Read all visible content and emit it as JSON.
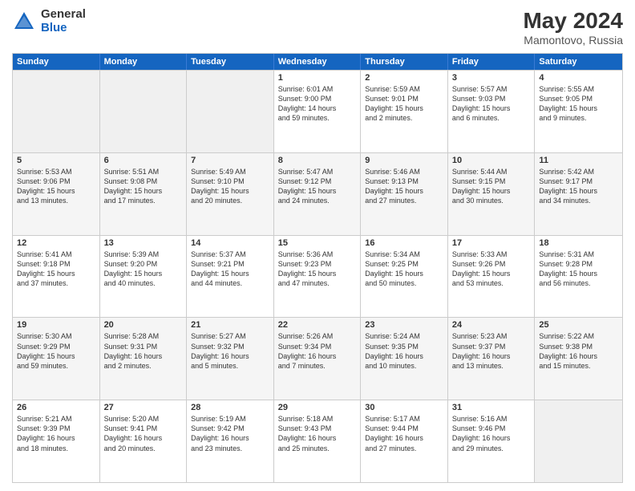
{
  "logo": {
    "general": "General",
    "blue": "Blue"
  },
  "title": "May 2024",
  "subtitle": "Mamontovo, Russia",
  "days": [
    "Sunday",
    "Monday",
    "Tuesday",
    "Wednesday",
    "Thursday",
    "Friday",
    "Saturday"
  ],
  "rows": [
    [
      {
        "day": "",
        "info": ""
      },
      {
        "day": "",
        "info": ""
      },
      {
        "day": "",
        "info": ""
      },
      {
        "day": "1",
        "info": "Sunrise: 6:01 AM\nSunset: 9:00 PM\nDaylight: 14 hours\nand 59 minutes."
      },
      {
        "day": "2",
        "info": "Sunrise: 5:59 AM\nSunset: 9:01 PM\nDaylight: 15 hours\nand 2 minutes."
      },
      {
        "day": "3",
        "info": "Sunrise: 5:57 AM\nSunset: 9:03 PM\nDaylight: 15 hours\nand 6 minutes."
      },
      {
        "day": "4",
        "info": "Sunrise: 5:55 AM\nSunset: 9:05 PM\nDaylight: 15 hours\nand 9 minutes."
      }
    ],
    [
      {
        "day": "5",
        "info": "Sunrise: 5:53 AM\nSunset: 9:06 PM\nDaylight: 15 hours\nand 13 minutes."
      },
      {
        "day": "6",
        "info": "Sunrise: 5:51 AM\nSunset: 9:08 PM\nDaylight: 15 hours\nand 17 minutes."
      },
      {
        "day": "7",
        "info": "Sunrise: 5:49 AM\nSunset: 9:10 PM\nDaylight: 15 hours\nand 20 minutes."
      },
      {
        "day": "8",
        "info": "Sunrise: 5:47 AM\nSunset: 9:12 PM\nDaylight: 15 hours\nand 24 minutes."
      },
      {
        "day": "9",
        "info": "Sunrise: 5:46 AM\nSunset: 9:13 PM\nDaylight: 15 hours\nand 27 minutes."
      },
      {
        "day": "10",
        "info": "Sunrise: 5:44 AM\nSunset: 9:15 PM\nDaylight: 15 hours\nand 30 minutes."
      },
      {
        "day": "11",
        "info": "Sunrise: 5:42 AM\nSunset: 9:17 PM\nDaylight: 15 hours\nand 34 minutes."
      }
    ],
    [
      {
        "day": "12",
        "info": "Sunrise: 5:41 AM\nSunset: 9:18 PM\nDaylight: 15 hours\nand 37 minutes."
      },
      {
        "day": "13",
        "info": "Sunrise: 5:39 AM\nSunset: 9:20 PM\nDaylight: 15 hours\nand 40 minutes."
      },
      {
        "day": "14",
        "info": "Sunrise: 5:37 AM\nSunset: 9:21 PM\nDaylight: 15 hours\nand 44 minutes."
      },
      {
        "day": "15",
        "info": "Sunrise: 5:36 AM\nSunset: 9:23 PM\nDaylight: 15 hours\nand 47 minutes."
      },
      {
        "day": "16",
        "info": "Sunrise: 5:34 AM\nSunset: 9:25 PM\nDaylight: 15 hours\nand 50 minutes."
      },
      {
        "day": "17",
        "info": "Sunrise: 5:33 AM\nSunset: 9:26 PM\nDaylight: 15 hours\nand 53 minutes."
      },
      {
        "day": "18",
        "info": "Sunrise: 5:31 AM\nSunset: 9:28 PM\nDaylight: 15 hours\nand 56 minutes."
      }
    ],
    [
      {
        "day": "19",
        "info": "Sunrise: 5:30 AM\nSunset: 9:29 PM\nDaylight: 15 hours\nand 59 minutes."
      },
      {
        "day": "20",
        "info": "Sunrise: 5:28 AM\nSunset: 9:31 PM\nDaylight: 16 hours\nand 2 minutes."
      },
      {
        "day": "21",
        "info": "Sunrise: 5:27 AM\nSunset: 9:32 PM\nDaylight: 16 hours\nand 5 minutes."
      },
      {
        "day": "22",
        "info": "Sunrise: 5:26 AM\nSunset: 9:34 PM\nDaylight: 16 hours\nand 7 minutes."
      },
      {
        "day": "23",
        "info": "Sunrise: 5:24 AM\nSunset: 9:35 PM\nDaylight: 16 hours\nand 10 minutes."
      },
      {
        "day": "24",
        "info": "Sunrise: 5:23 AM\nSunset: 9:37 PM\nDaylight: 16 hours\nand 13 minutes."
      },
      {
        "day": "25",
        "info": "Sunrise: 5:22 AM\nSunset: 9:38 PM\nDaylight: 16 hours\nand 15 minutes."
      }
    ],
    [
      {
        "day": "26",
        "info": "Sunrise: 5:21 AM\nSunset: 9:39 PM\nDaylight: 16 hours\nand 18 minutes."
      },
      {
        "day": "27",
        "info": "Sunrise: 5:20 AM\nSunset: 9:41 PM\nDaylight: 16 hours\nand 20 minutes."
      },
      {
        "day": "28",
        "info": "Sunrise: 5:19 AM\nSunset: 9:42 PM\nDaylight: 16 hours\nand 23 minutes."
      },
      {
        "day": "29",
        "info": "Sunrise: 5:18 AM\nSunset: 9:43 PM\nDaylight: 16 hours\nand 25 minutes."
      },
      {
        "day": "30",
        "info": "Sunrise: 5:17 AM\nSunset: 9:44 PM\nDaylight: 16 hours\nand 27 minutes."
      },
      {
        "day": "31",
        "info": "Sunrise: 5:16 AM\nSunset: 9:46 PM\nDaylight: 16 hours\nand 29 minutes."
      },
      {
        "day": "",
        "info": ""
      }
    ]
  ]
}
